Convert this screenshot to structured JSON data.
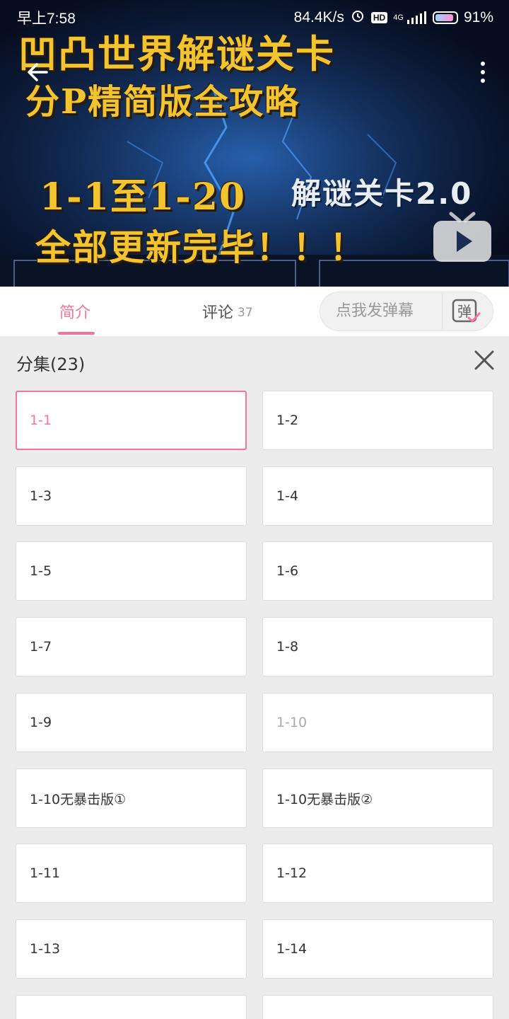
{
  "status_bar": {
    "time": "早上7:58",
    "net_speed": "84.4K/s",
    "hd_badge": "HD",
    "signal": "4G",
    "battery": "91%",
    "battery_level": 0.91
  },
  "video": {
    "overlay_line1": "凹凸世界解谜关卡",
    "overlay_line2": "分P精简版全攻略",
    "overlay_line3": "1-1至1-20",
    "overlay_line4": "全部更新完毕！！！",
    "overlay_badge": "解谜关卡2.0",
    "icons": [
      "back-arrow-icon",
      "more-vertical-icon",
      "tv-play-icon"
    ]
  },
  "tabs": {
    "intro": "简介",
    "comments": "评论",
    "comments_count": "37",
    "danmaku_placeholder": "点我发弹幕",
    "danmaku_icon_char": "弹"
  },
  "episodes": {
    "title": "分集(23)",
    "items": [
      {
        "label": "1-1",
        "state": "active"
      },
      {
        "label": "1-2",
        "state": "normal"
      },
      {
        "label": "1-3",
        "state": "normal"
      },
      {
        "label": "1-4",
        "state": "normal"
      },
      {
        "label": "1-5",
        "state": "normal"
      },
      {
        "label": "1-6",
        "state": "normal"
      },
      {
        "label": "1-7",
        "state": "normal"
      },
      {
        "label": "1-8",
        "state": "normal"
      },
      {
        "label": "1-9",
        "state": "normal"
      },
      {
        "label": "1-10",
        "state": "watched"
      },
      {
        "label": "1-10无暴击版①",
        "state": "normal"
      },
      {
        "label": "1-10无暴击版②",
        "state": "normal"
      },
      {
        "label": "1-11",
        "state": "normal"
      },
      {
        "label": "1-12",
        "state": "normal"
      },
      {
        "label": "1-13",
        "state": "normal"
      },
      {
        "label": "1-14",
        "state": "normal"
      },
      {
        "label": "",
        "state": "normal"
      },
      {
        "label": "",
        "state": "normal"
      }
    ]
  },
  "colors": {
    "accent": "#fb7299",
    "panel_bg": "#ececec",
    "card_bg": "#ffffff",
    "title_yellow": "#f2c430"
  }
}
